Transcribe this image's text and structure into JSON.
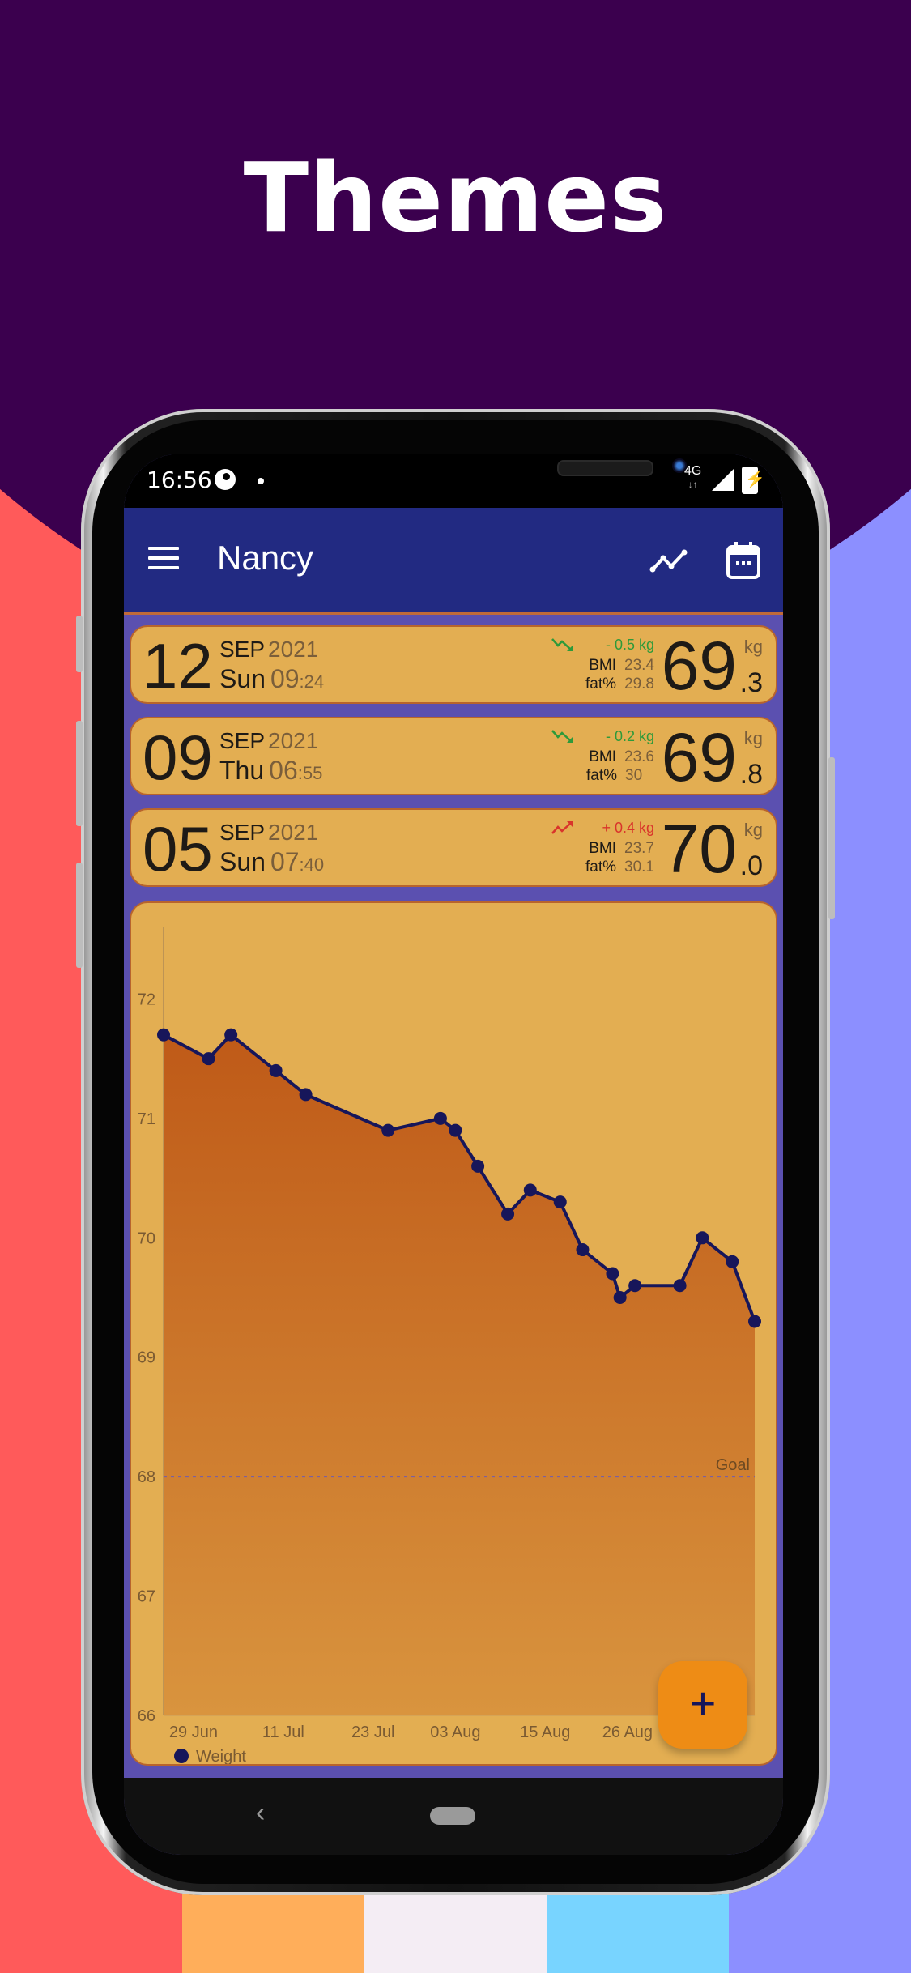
{
  "banner": {
    "title": "Themes",
    "background_color": "#3B004E",
    "stripe_colors": [
      "#FF5A5A",
      "#FFAE5A",
      "#F4EDF4",
      "#78D4FF",
      "#8C8FFF"
    ]
  },
  "status_bar": {
    "time": "16:56",
    "network": "4G",
    "network_arrows": "↓↑"
  },
  "app_bar": {
    "menu_icon": "hamburger-menu-icon",
    "title": "Nancy",
    "chart_icon": "line-chart-icon",
    "calendar_icon": "calendar-icon",
    "color": "#222A82"
  },
  "entries": [
    {
      "day": "12",
      "month": "SEP",
      "year": "2021",
      "weekday": "Sun",
      "hour": "09",
      "minute": ":24",
      "trend": "down",
      "delta": "- 0.5 kg",
      "bmi_label": "BMI",
      "bmi": "23.4",
      "fat_label": "fat%",
      "fat": "29.8",
      "weight_int": "69",
      "weight_dec": ".3",
      "unit": "kg"
    },
    {
      "day": "09",
      "month": "SEP",
      "year": "2021",
      "weekday": "Thu",
      "hour": "06",
      "minute": ":55",
      "trend": "down",
      "delta": "- 0.2 kg",
      "bmi_label": "BMI",
      "bmi": "23.6",
      "fat_label": "fat%",
      "fat": "30",
      "weight_int": "69",
      "weight_dec": ".8",
      "unit": "kg"
    },
    {
      "day": "05",
      "month": "SEP",
      "year": "2021",
      "weekday": "Sun",
      "hour": "07",
      "minute": ":40",
      "trend": "up",
      "delta": "+ 0.4 kg",
      "bmi_label": "BMI",
      "bmi": "23.7",
      "fat_label": "fat%",
      "fat": "30.1",
      "weight_int": "70",
      "weight_dec": ".0",
      "unit": "kg"
    }
  ],
  "colors": {
    "trend_down": "#2E9A3A",
    "trend_up": "#D9342B",
    "card_bg": "#E3AE52",
    "line": "#17165A"
  },
  "chart_data": {
    "type": "area",
    "title": "",
    "xlabel": "",
    "ylabel": "",
    "ylim": [
      66,
      72.6
    ],
    "yticks": [
      66,
      67,
      68,
      69,
      70,
      71,
      72
    ],
    "xticks": [
      {
        "label": "29 Jun",
        "day": 4
      },
      {
        "label": "11 Jul",
        "day": 16
      },
      {
        "label": "23 Jul",
        "day": 28
      },
      {
        "label": "03 Aug",
        "day": 39
      },
      {
        "label": "15 Aug",
        "day": 51
      },
      {
        "label": "26 Aug",
        "day": 62
      }
    ],
    "xlim_days": [
      0,
      79
    ],
    "x_day_zero": "25 Jun",
    "goal": {
      "label": "Goal",
      "value": 68
    },
    "legend": {
      "label": "Weight",
      "position": "bottom-left"
    },
    "series": [
      {
        "name": "Weight",
        "x_days": [
          0,
          6,
          9,
          15,
          19,
          30,
          37,
          39,
          42,
          46,
          49,
          53,
          56,
          60,
          61,
          63,
          69,
          72,
          76,
          79
        ],
        "values": [
          71.7,
          71.5,
          71.7,
          71.4,
          71.2,
          70.9,
          71.0,
          70.9,
          70.6,
          70.2,
          70.4,
          70.3,
          69.9,
          69.7,
          69.5,
          69.6,
          69.6,
          70.0,
          69.8,
          69.3
        ]
      }
    ]
  },
  "fab": {
    "label": "+",
    "icon": "plus-icon"
  },
  "nav": {
    "back": "‹"
  }
}
